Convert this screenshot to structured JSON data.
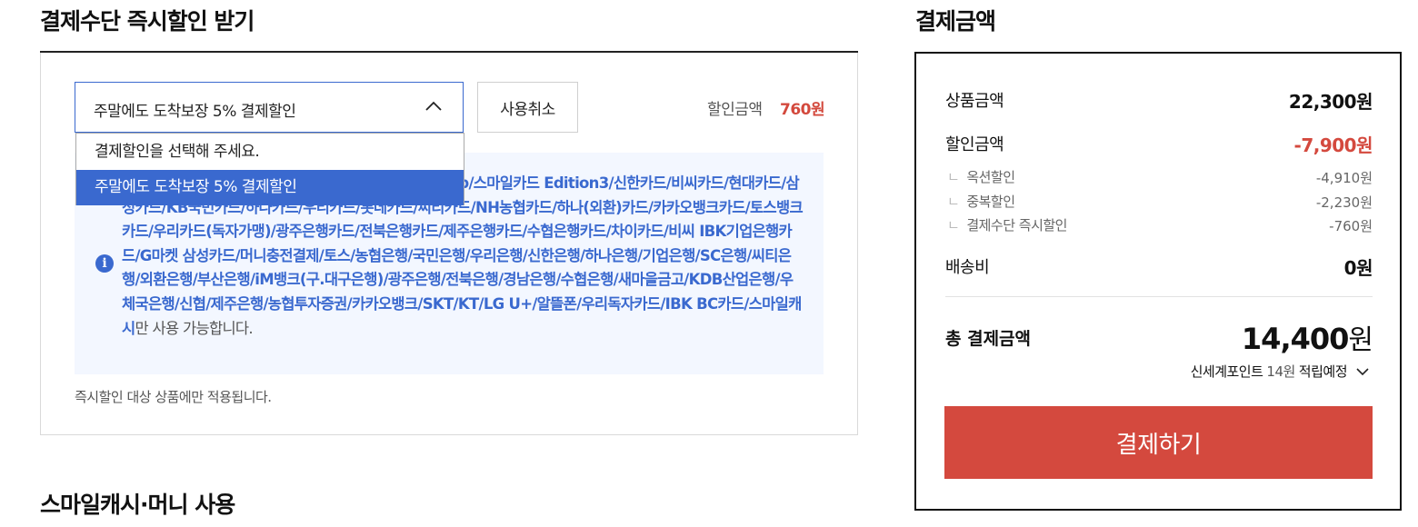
{
  "payment_method_section": {
    "title": "결제수단 즉시할인 받기",
    "selected_discount": "주말에도 도착보장 5% 결제할인",
    "cancel_label": "사용취소",
    "discount_amount_label": "할인금액",
    "discount_amount_value": "760원",
    "dropdown_options": [
      "결제할인을 선택해 주세요.",
      "주말에도 도착보장 5% 결제할인"
    ],
    "info_text_bold": "스마일카드/스마일카드 Edition2/스마일카드 the Club/스마일카드 Edition3/신한카드/비씨카드/현대카드/삼성카드/KB국민카드/하나카드/우리카드/롯데카드/씨티카드/NH농협카드/하나(외환)카드/카카오뱅크카드/토스뱅크카드/우리카드(독자가맹)/광주은행카드/전북은행카드/제주은행카드/수협은행카드/차이카드/비씨 IBK기업은행카드/G마켓 삼성카드/머니충전결제/토스/농협은행/국민은행/우리은행/신한은행/하나은행/기업은행/SC은행/씨티은행/외환은행/부산은행/iM뱅크(구.대구은행)/광주은행/전북은행/경남은행/수협은행/새마을금고/KDB산업은행/우체국은행/신협/제주은행/농협투자증권/카카오뱅크/SKT/KT/LG U+/알뜰폰/우리독자카드/IBK BC카드/스마일캐시",
    "info_text_tail": "만 사용 가능합니다.",
    "note": "즉시할인 대상 상품에만 적용됩니다."
  },
  "smile_cash_section": {
    "title": "스마일캐시·머니 사용"
  },
  "summary": {
    "title": "결제금액",
    "product_label": "상품금액",
    "product_value": "22,300원",
    "discount_label": "할인금액",
    "discount_value": "-7,900원",
    "sub_discounts": [
      {
        "label": "옥션할인",
        "value": "-4,910원"
      },
      {
        "label": "중복할인",
        "value": "-2,230원"
      },
      {
        "label": "결제수단 즉시할인",
        "value": "-760원"
      }
    ],
    "shipping_label": "배송비",
    "shipping_value": "0원",
    "total_label": "총 결제금액",
    "total_number": "14,400",
    "total_unit": "원",
    "points_name": "신세계포인트",
    "points_amount": "14원",
    "points_suffix": "적립예정",
    "pay_button": "결제하기"
  },
  "colors": {
    "accent_blue": "#3a69cf",
    "accent_red": "#d4493e",
    "info_bg": "#f3f7ff"
  }
}
